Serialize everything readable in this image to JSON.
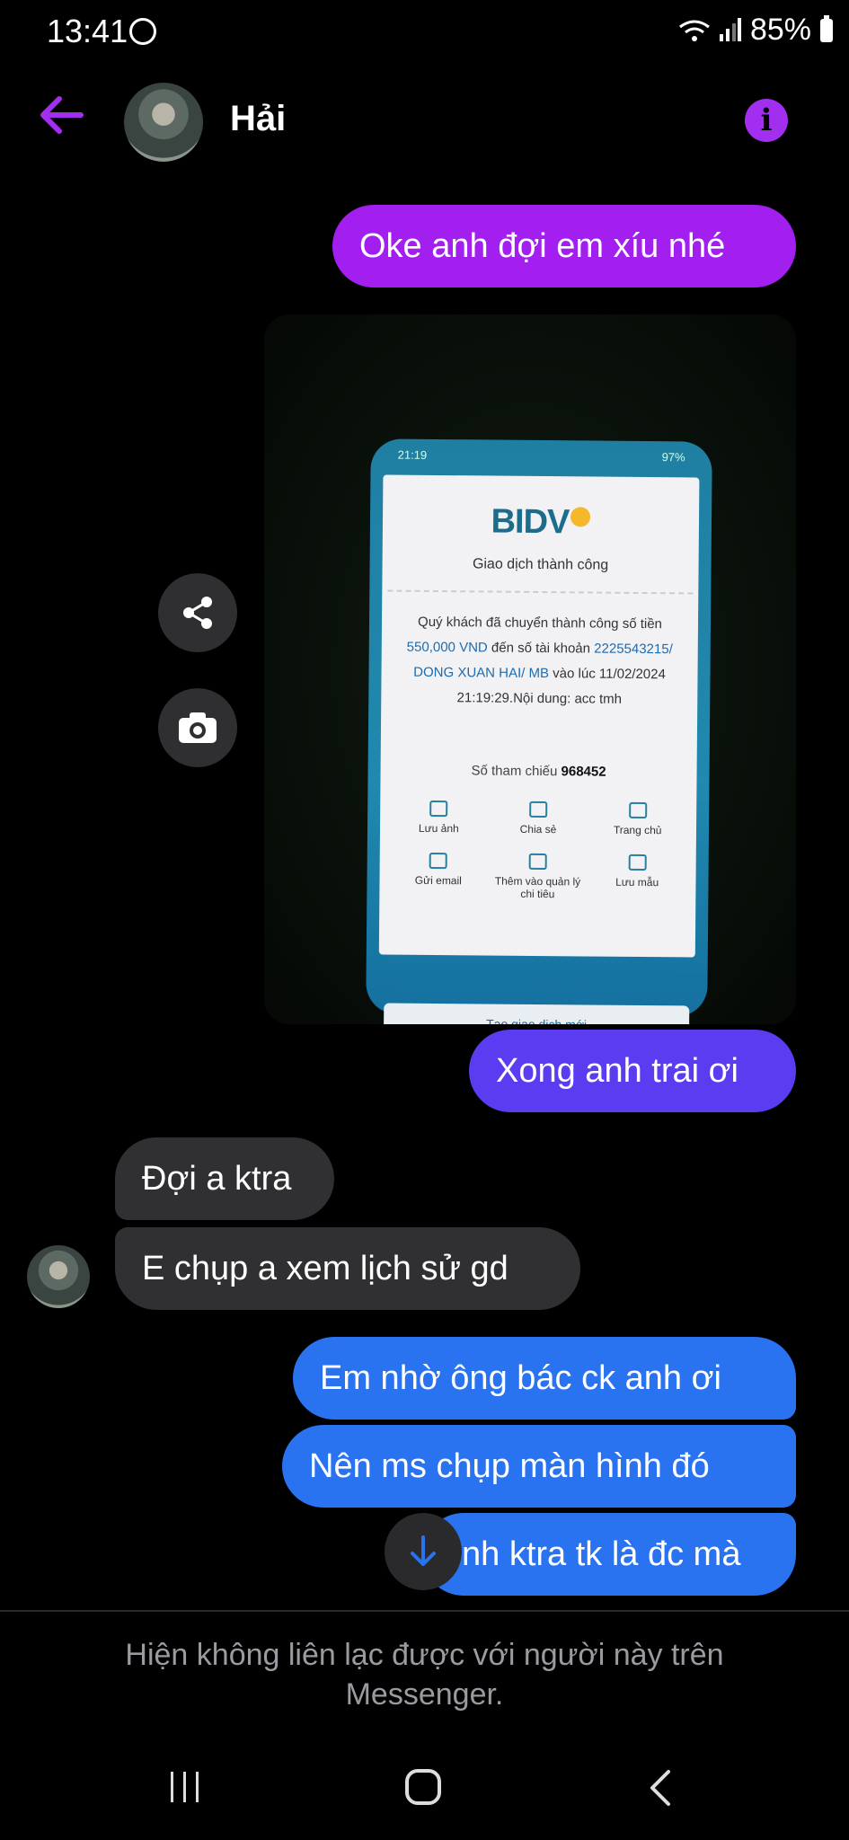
{
  "status_bar": {
    "time": "13:41",
    "battery": "85%"
  },
  "header": {
    "contact_name": "Hải"
  },
  "messages": [
    {
      "text": "Oke anh đợi em xíu nhé"
    },
    {
      "text": "Xong anh trai ơi"
    },
    {
      "text": "Đợi a ktra"
    },
    {
      "text": "E chụp a xem lịch sử gd"
    },
    {
      "text": "Em nhờ ông bác ck anh ơi"
    },
    {
      "text": "Nên ms chụp màn hình đó"
    },
    {
      "text": "nh ktra tk là đc mà"
    }
  ],
  "photo": {
    "phone_time": "21:19",
    "phone_battery": "97%",
    "bank_logo": "BIDV",
    "title": "Giao dịch thành công",
    "body_1": "Quý khách đã chuyển thành công số tiền",
    "amount": "550,000 VND",
    "body_2": "đến số tài khoản",
    "account": "2225543215",
    "recipient": "/ DONG XUAN HAI/ MB",
    "body_3": "vào lúc 11/02/2024 21:19:29.Nội dung: acc tmh",
    "ref_label": "Số tham chiếu",
    "ref_value": "968452",
    "actions": [
      "Lưu ảnh",
      "Chia sẻ",
      "Trang chủ",
      "Gửi email",
      "Thêm vào quản lý chi tiêu",
      "Lưu mẫu"
    ],
    "new_tx": "Tạo giao dịch mới"
  },
  "footer": {
    "notice": "Hiện không liên lạc được với người này trên Messenger."
  },
  "colors": {
    "purple": "#a31ff0",
    "indigo": "#5b3cf0",
    "blue": "#2a73f0",
    "incoming": "#303033"
  }
}
